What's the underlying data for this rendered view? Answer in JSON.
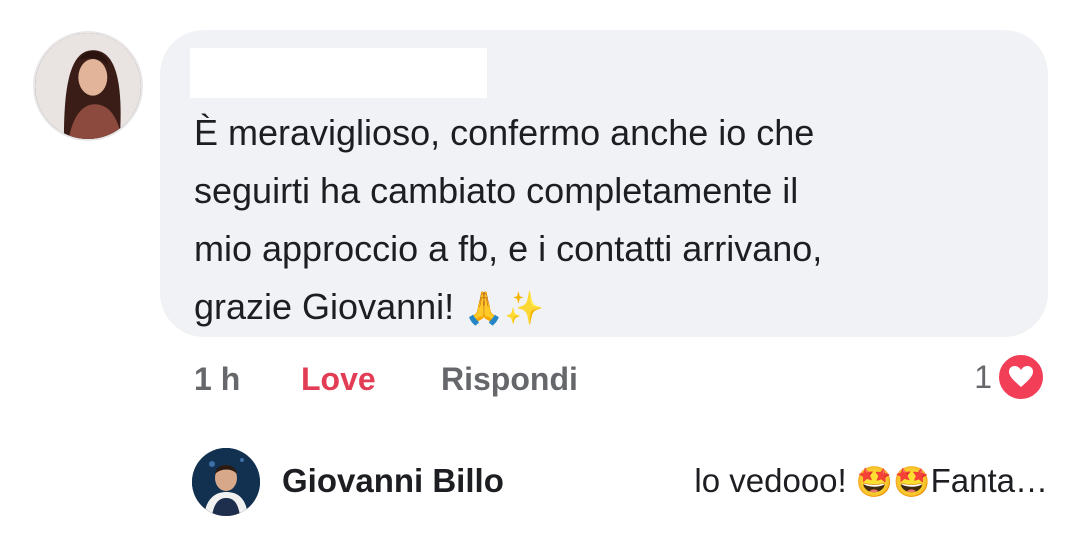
{
  "comment": {
    "author_avatar": "woman-profile-photo",
    "author_name_redacted": true,
    "text_line1": "È meraviglioso, confermo anche io che",
    "text_line2": "seguirti ha cambiato completamente il",
    "text_line3": "mio approccio a fb, e i contatti arrivano,",
    "text_line4": "grazie Giovanni! ",
    "emoji_pray": "🙏",
    "emoji_sparkles": "✨"
  },
  "actions": {
    "time": "1 h",
    "love": "Love",
    "reply": "Rispondi",
    "reaction_count": "1",
    "reaction_icon": "heart-icon",
    "reaction_color": "#f33e58"
  },
  "reply": {
    "author_name": "Giovanni Billo",
    "snippet_text": "lo vedooo! ",
    "snippet_emojis": "🤩🤩",
    "snippet_tail": "Fanta…"
  },
  "colors": {
    "bubble": "#f0f2f5",
    "love": "#e23d55",
    "muted": "#65676b"
  }
}
